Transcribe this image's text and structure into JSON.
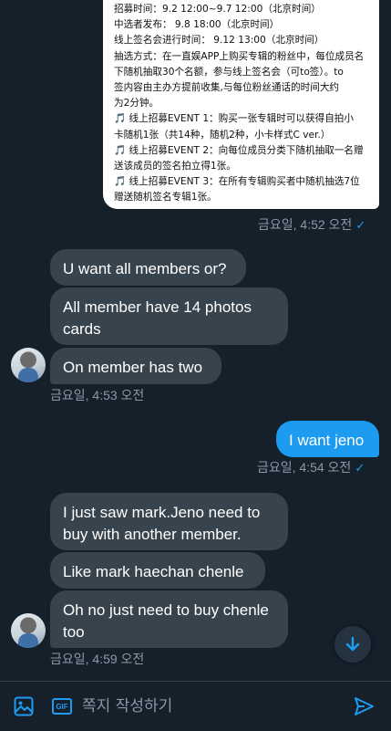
{
  "colors": {
    "background": "#15202b",
    "incoming_bubble": "#38444d",
    "outgoing_bubble": "#1d9bf0",
    "accent": "#1d9bf0"
  },
  "shared_image_lines": [
    "招募时间：9.2  12:00~9.7  12:00（北京时间）",
    "中选者发布：  9.8  18:00（北京时间）",
    "线上签名会进行时间：  9.12  13:00（北京时间）",
    "抽选方式：在一直娱APP上购买专辑的粉丝中，每位成员名",
    "下随机抽取30个名额，参与线上签名会（可to签）。to",
    "签内容由主办方提前收集,与每位粉丝通话的时间大约",
    "为2分钟。",
    "🎵 线上招募EVENT 1：购买一张专辑时可以获得自拍小",
    "卡随机1张（共14种，随机2种，小卡样式C ver.）",
    "🎵 线上招募EVENT 2：向每位成员分类下随机抽取一名赠",
    "送该成员的签名拍立得1张。",
    "🎵 线上招募EVENT 3：在所有专辑购买者中随机抽选7位",
    "赠送随机签名专辑1张。"
  ],
  "messages": {
    "t1": "금요일, 4:52 오전",
    "b1": "U want all members or?",
    "b2": "All member have 14 photos cards",
    "b3": "On member has two",
    "t2": "금요일, 4:53 오전",
    "b4": "I want jeno",
    "t3": "금요일, 4:54 오전",
    "b5": "I just saw mark.Jeno need to buy with another member.",
    "b6": "Like mark haechan chenle",
    "b7": "Oh no just need to buy chenle too",
    "t4": "금요일, 4:59 오전"
  },
  "composer": {
    "placeholder": "쪽지 작성하기",
    "gif_label": "GIF"
  },
  "icons": {
    "read_check": "✓",
    "image": "image-icon",
    "gif": "gif-icon",
    "send": "send-icon",
    "scroll_down": "arrow-down-icon"
  }
}
